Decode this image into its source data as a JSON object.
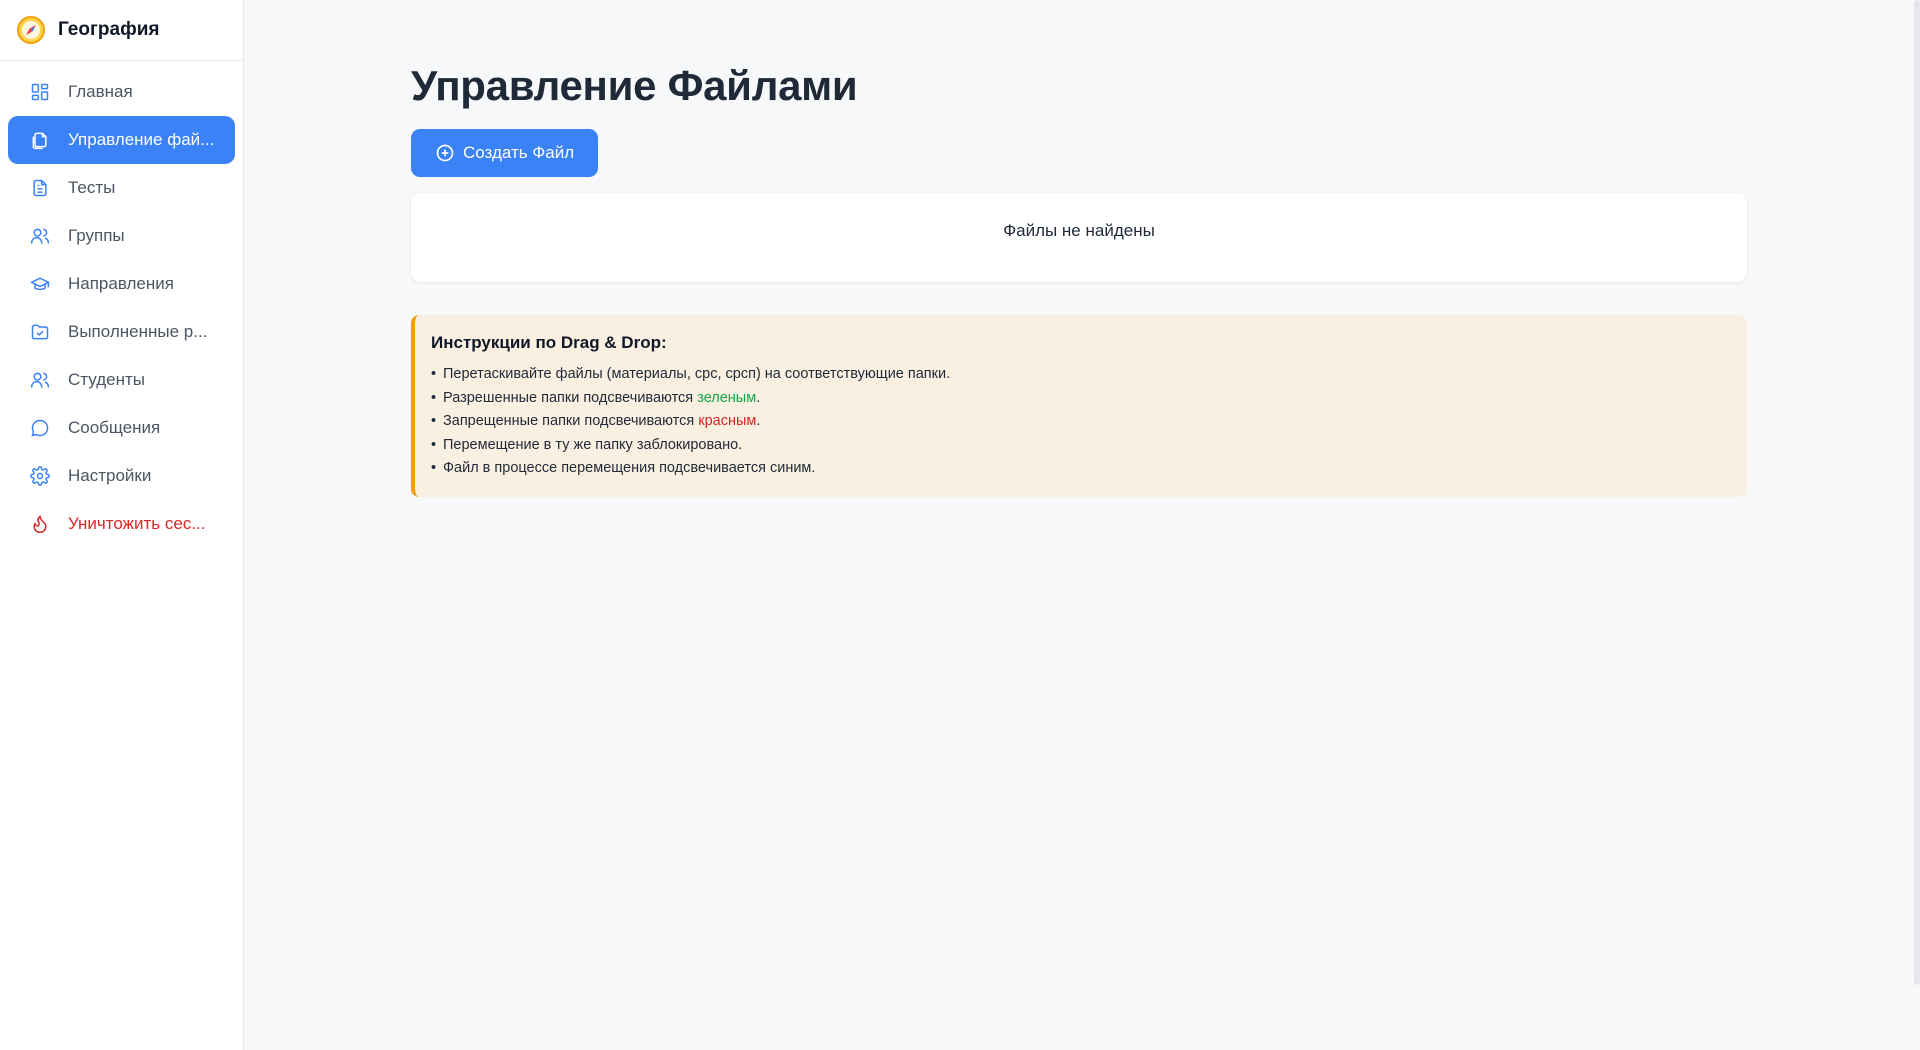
{
  "app": {
    "name": "География"
  },
  "sidebar": {
    "items": [
      {
        "label": "Главная",
        "icon": "dashboard-icon",
        "state": "normal"
      },
      {
        "label": "Управление фай...",
        "icon": "files-icon",
        "state": "active"
      },
      {
        "label": "Тесты",
        "icon": "document-icon",
        "state": "normal"
      },
      {
        "label": "Группы",
        "icon": "users-icon",
        "state": "normal"
      },
      {
        "label": "Направления",
        "icon": "graduation-cap-icon",
        "state": "normal"
      },
      {
        "label": "Выполненные р...",
        "icon": "folder-check-icon",
        "state": "normal"
      },
      {
        "label": "Студенты",
        "icon": "users-icon",
        "state": "normal"
      },
      {
        "label": "Сообщения",
        "icon": "message-icon",
        "state": "normal"
      },
      {
        "label": "Настройки",
        "icon": "gear-icon",
        "state": "normal"
      },
      {
        "label": "Уничтожить сес...",
        "icon": "flame-icon",
        "state": "danger"
      }
    ]
  },
  "main": {
    "title": "Управление Файлами",
    "create_button": "Создать Файл",
    "empty_message": "Файлы не найдены",
    "instructions": {
      "title": "Инструкции по Drag & Drop:",
      "items": [
        {
          "before": "Перетаскивайте файлы (материалы, срс, срсп) на соответствующие папки.",
          "highlight": "",
          "after": ""
        },
        {
          "before": "Разрешенные папки подсвечиваются ",
          "highlight": "зеленым",
          "after": "."
        },
        {
          "before": "Запрещенные папки подсвечиваются ",
          "highlight": "красным",
          "after": "."
        },
        {
          "before": "Перемещение в ту же папку заблокировано.",
          "highlight": "",
          "after": ""
        },
        {
          "before": "Файл в процессе перемещения подсвечивается синим.",
          "highlight": "",
          "after": ""
        }
      ]
    }
  },
  "colors": {
    "accent": "#3b82f6",
    "danger": "#dc2626",
    "success": "#16a34a",
    "warning_border": "#f59e0b",
    "warning_bg": "#f9f0e1"
  }
}
